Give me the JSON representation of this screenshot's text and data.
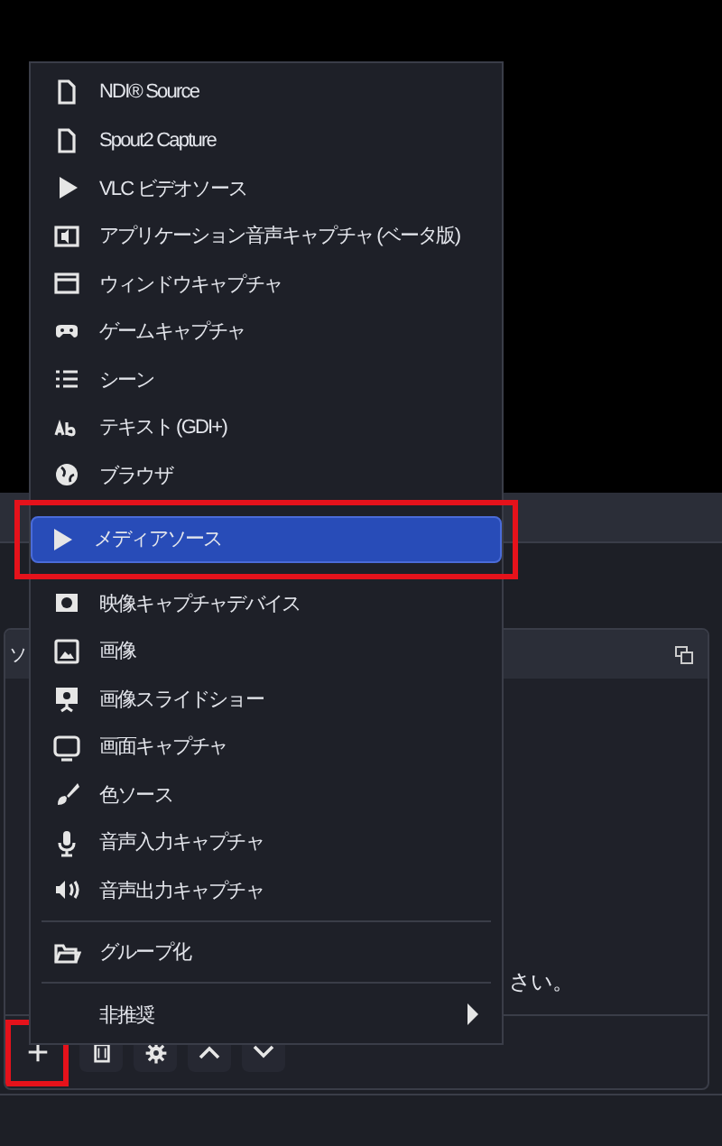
{
  "dock": {
    "title": "ソ",
    "message": "さい。"
  },
  "toolbar": [
    {
      "kind": "add",
      "highlighted": true
    },
    {
      "kind": "remove",
      "highlighted": false
    },
    {
      "kind": "settings",
      "highlighted": false
    },
    {
      "kind": "up",
      "highlighted": false
    },
    {
      "kind": "down",
      "highlighted": false
    }
  ],
  "menu": {
    "groups": [
      [
        {
          "label": "NDI® Source",
          "kind": "item",
          "selected": false
        },
        {
          "label": "Spout2 Capture",
          "kind": "item",
          "selected": false
        },
        {
          "label": "VLC ビデオソース",
          "kind": "item",
          "selected": false
        },
        {
          "label": "アプリケーション音声キャプチャ (ベータ版)",
          "kind": "item",
          "selected": false
        },
        {
          "label": "ウィンドウキャプチャ",
          "kind": "item",
          "selected": false
        },
        {
          "label": "ゲームキャプチャ",
          "kind": "item",
          "selected": false
        },
        {
          "label": "シーン",
          "kind": "item",
          "selected": false
        },
        {
          "label": "テキスト (GDI+)",
          "kind": "item",
          "selected": false
        },
        {
          "label": "ブラウザ",
          "kind": "item",
          "selected": false
        },
        {
          "label": "メディアソース",
          "kind": "item",
          "selected": true
        },
        {
          "label": "映像キャプチャデバイス",
          "kind": "item",
          "selected": false
        },
        {
          "label": "画像",
          "kind": "item",
          "selected": false
        },
        {
          "label": "画像スライドショー",
          "kind": "item",
          "selected": false
        },
        {
          "label": "画面キャプチャ",
          "kind": "item",
          "selected": false
        },
        {
          "label": "色ソース",
          "kind": "item",
          "selected": false
        },
        {
          "label": "音声入力キャプチャ",
          "kind": "item",
          "selected": false
        },
        {
          "label": "音声出力キャプチャ",
          "kind": "item",
          "selected": false
        }
      ],
      [
        {
          "label": "グループ化",
          "kind": "item",
          "selected": false
        }
      ],
      [
        {
          "label": "非推奨",
          "kind": "submenu",
          "selected": false
        }
      ]
    ]
  }
}
